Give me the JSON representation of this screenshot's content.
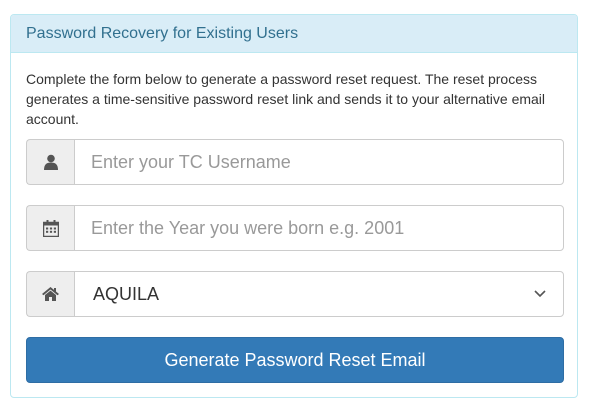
{
  "panel": {
    "title": "Password Recovery for Existing Users",
    "intro": "Complete the form below to generate a password reset request. The reset process generates a time-sensitive password reset link and sends it to your alternative email account."
  },
  "form": {
    "username": {
      "value": "",
      "placeholder": "Enter your TC Username",
      "icon": "user-icon"
    },
    "birth_year": {
      "value": "",
      "placeholder": "Enter the Year you were born e.g. 2001",
      "icon": "calendar-icon"
    },
    "campus": {
      "selected": "AQUILA",
      "icon": "home-icon"
    },
    "submit_label": "Generate Password Reset Email"
  },
  "colors": {
    "heading_bg": "#d9edf7",
    "heading_text": "#31708f",
    "panel_border": "#bce8f1",
    "button_bg": "#337ab7"
  }
}
